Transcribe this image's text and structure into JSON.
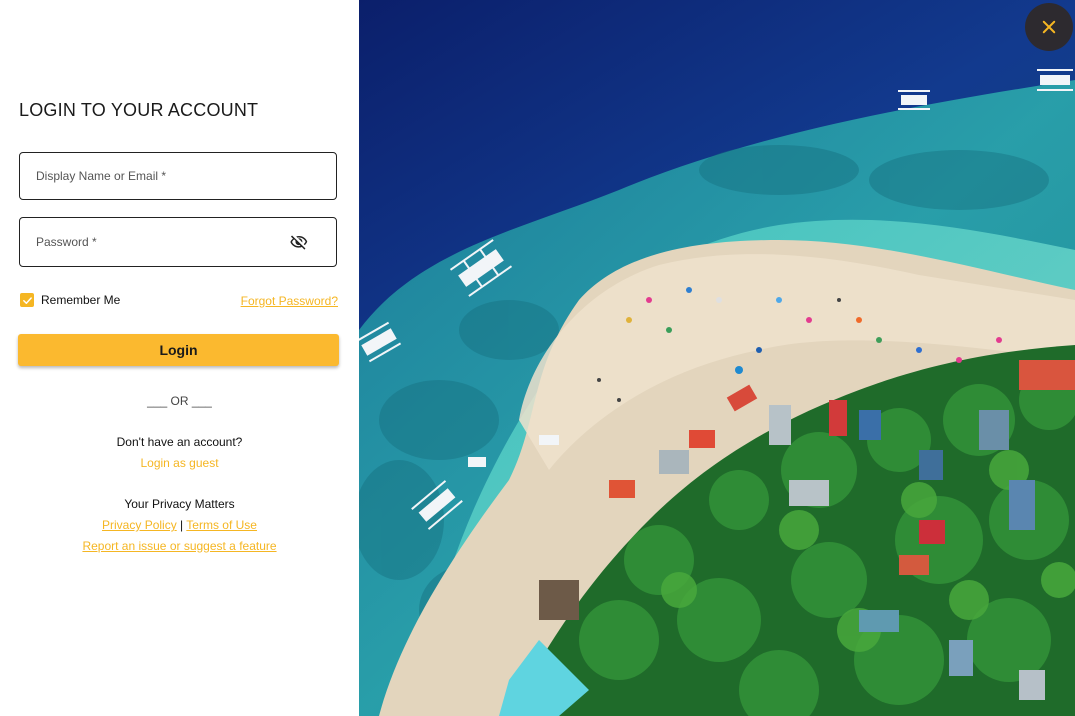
{
  "login": {
    "title": "LOGIN TO YOUR ACCOUNT",
    "email_placeholder": "Display Name or Email *",
    "password_placeholder": "Password *",
    "remember_label": "Remember Me",
    "remember_checked": true,
    "forgot_label": "Forgot Password?",
    "login_button": "Login",
    "or_divider": "___ OR ___",
    "no_account": "Don't have an account?",
    "guest_link": "Login as guest",
    "privacy_title": "Your Privacy Matters",
    "privacy_policy": "Privacy Policy",
    "separator": "|",
    "terms": "Terms of Use",
    "report": "Report an issue or suggest a feature"
  },
  "theme": {
    "accent": "#fbb92f",
    "link": "#f5b623"
  },
  "icons": {
    "password_toggle": "eye-off-icon",
    "checkbox": "check-icon",
    "close": "close-icon"
  }
}
